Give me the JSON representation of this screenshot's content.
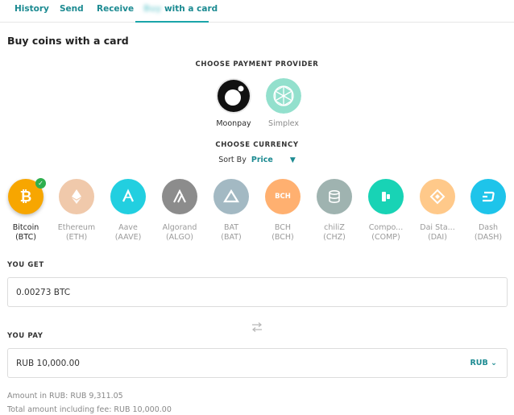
{
  "tabs": [
    {
      "label": "History"
    },
    {
      "label": "Send"
    },
    {
      "label": "Receive"
    },
    {
      "label_prefix": "Buy",
      "label": "with a card"
    }
  ],
  "page_title": "Buy coins with a card",
  "providers": {
    "label": "CHOOSE PAYMENT PROVIDER",
    "items": [
      {
        "name": "Moonpay",
        "selected": true
      },
      {
        "name": "Simplex",
        "selected": false
      }
    ]
  },
  "currency": {
    "label": "CHOOSE CURRENCY",
    "sort_label": "Sort By",
    "sort_value": "Price",
    "coins": [
      {
        "name": "Bitcoin",
        "symbol": "(BTC)",
        "color": "#f7a600",
        "icon": "bitcoin-icon",
        "glyph": "₿",
        "selected": true
      },
      {
        "name": "Ethereum",
        "symbol": "(ETH)",
        "color": "#f0c9ab",
        "icon": "ethereum-icon",
        "selected": false
      },
      {
        "name": "Aave",
        "symbol": "(AAVE)",
        "color": "#22cfe0",
        "icon": "aave-icon",
        "selected": false
      },
      {
        "name": "Algorand",
        "symbol": "(ALGO)",
        "color": "#8c8c8c",
        "icon": "algorand-icon",
        "selected": false
      },
      {
        "name": "BAT",
        "symbol": "(BAT)",
        "color": "#a3b9c3",
        "icon": "bat-icon",
        "selected": false
      },
      {
        "name": "BCH",
        "symbol": "(BCH)",
        "color": "#ffb070",
        "icon": "bch-icon",
        "glyph": "BCH",
        "selected": false
      },
      {
        "name": "chiliZ",
        "symbol": "(CHZ)",
        "color": "#9fb3b0",
        "icon": "chiliz-icon",
        "selected": false
      },
      {
        "name": "Compo...",
        "symbol": "(COMP)",
        "color": "#18d3b5",
        "icon": "compound-icon",
        "selected": false
      },
      {
        "name": "Dai Sta...",
        "symbol": "(DAI)",
        "color": "#ffc98a",
        "icon": "dai-icon",
        "selected": false
      },
      {
        "name": "Dash",
        "symbol": "(DASH)",
        "color": "#1ec4ea",
        "icon": "dash-icon",
        "selected": false
      }
    ]
  },
  "you_get": {
    "label": "YOU GET",
    "value": "0.00273 BTC"
  },
  "you_pay": {
    "label": "YOU PAY",
    "value": "RUB 10,000.00",
    "currency": "RUB"
  },
  "summary": {
    "amount": "Amount in RUB: RUB 9,311.05",
    "total": "Total amount including fee: RUB 10,000.00"
  },
  "colors": {
    "accent": "#1b8a91",
    "check": "#2eaf4e"
  }
}
